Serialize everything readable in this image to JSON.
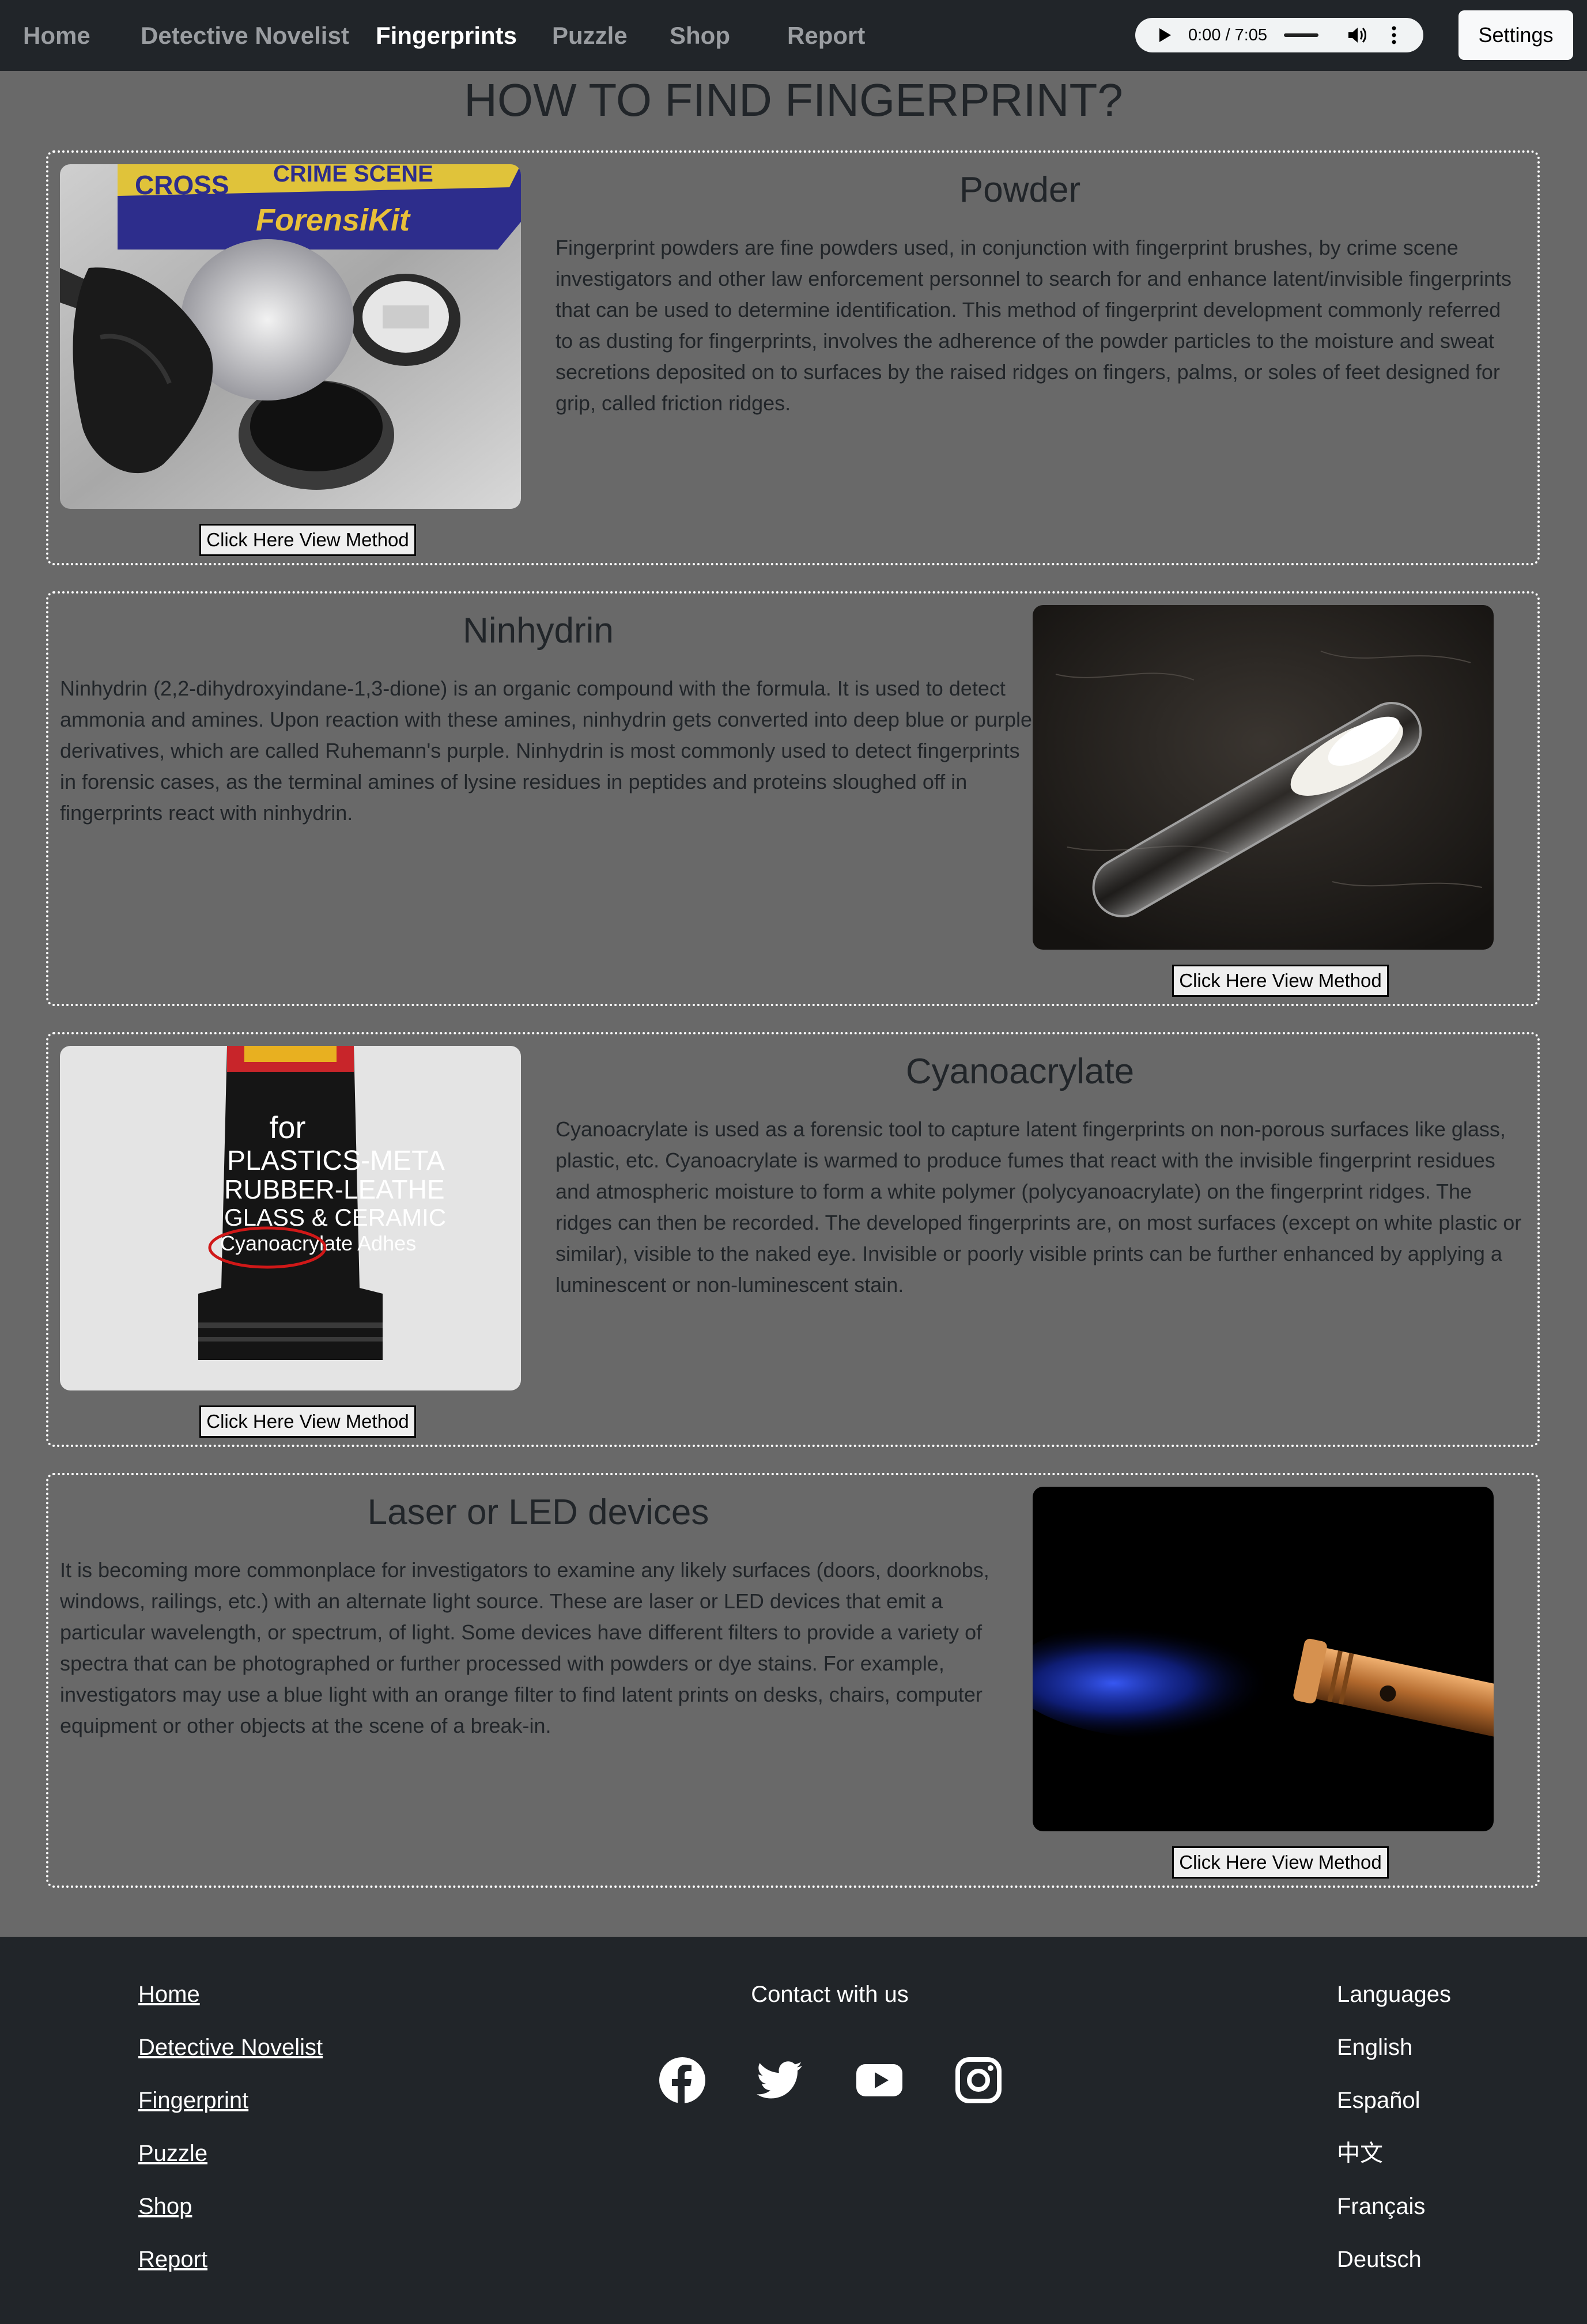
{
  "nav": {
    "items": [
      "Home",
      "Detective Novelist",
      "Fingerprints",
      "Puzzle",
      "Shop",
      "Report"
    ],
    "active": "Fingerprints",
    "audio_time": "0:00 / 7:05",
    "settings_label": "Settings"
  },
  "page_title": "HOW TO FIND FINGERPRINT?",
  "methods": [
    {
      "title": "Powder",
      "text": "Fingerprint powders are fine powders used, in conjunction with fingerprint brushes, by crime scene investigators and other law enforcement personnel to search for and enhance latent/invisible fingerprints that can be used to determine identification. This method of fingerprint development commonly referred to as dusting for fingerprints, involves the adherence of the powder particles to the moisture and sweat secretions deposited on to surfaces by the raised ridges on fingers, palms, or soles of feet designed for grip, called friction ridges.",
      "button": "Click Here View Method",
      "image_text": [
        "CROSS",
        "CRIME SCENE",
        "ForensiKit"
      ]
    },
    {
      "title": "Ninhydrin",
      "text": "Ninhydrin (2,2-dihydroxyindane-1,3-dione) is an organic compound with the formula. It is used to detect ammonia and amines. Upon reaction with these amines, ninhydrin gets converted into deep blue or purple derivatives, which are called Ruhemann's purple. Ninhydrin is most commonly used to detect fingerprints in forensic cases, as the terminal amines of lysine residues in peptides and proteins sloughed off in fingerprints react with ninhydrin.",
      "button": "Click Here View Method"
    },
    {
      "title": "Cyanoacrylate",
      "text": "Cyanoacrylate is used as a forensic tool to capture latent fingerprints on non-porous surfaces like glass, plastic, etc. Cyanoacrylate is warmed to produce fumes that react with the invisible fingerprint residues and atmospheric moisture to form a white polymer (polycyanoacrylate) on the fingerprint ridges. The ridges can then be recorded. The developed fingerprints are, on most surfaces (except on white plastic or similar), visible to the naked eye. Invisible or poorly visible prints can be further enhanced by applying a luminescent or non-luminescent stain.",
      "button": "Click Here View Method",
      "image_text": [
        "for",
        "PLASTICS-META",
        "RUBBER-LEATHE",
        "GLASS & CERAMIC",
        "Cyanoacrylate Adhes"
      ]
    },
    {
      "title": "Laser or LED devices",
      "text": "It is becoming more commonplace for investigators to examine any likely surfaces (doors, doorknobs, windows, railings, etc.) with an alternate light source. These are laser or LED devices that emit a particular wavelength, or spectrum, of light. Some devices have different filters to provide a variety of spectra that can be photographed or further processed with powders or dye stains. For example, investigators may use a blue light with an orange filter to find latent prints on desks, chairs, computer equipment or other objects at the scene of a break-in.",
      "button": "Click Here View Method"
    }
  ],
  "footer": {
    "links": [
      "Home",
      "Detective Novelist",
      "Fingerprint",
      "Puzzle",
      "Shop",
      "Report"
    ],
    "contact_title": "Contact with us",
    "social_icons": [
      "facebook-icon",
      "twitter-icon",
      "youtube-icon",
      "instagram-icon"
    ],
    "languages_title": "Languages",
    "languages": [
      "English",
      "Español",
      "中文",
      "Français",
      "Deutsch"
    ]
  },
  "colors": {
    "navbar": "#212529",
    "page_bg": "#696969",
    "footer": "#212529",
    "active_nav": "#ffffff",
    "inactive_nav": "#9a9da1"
  }
}
